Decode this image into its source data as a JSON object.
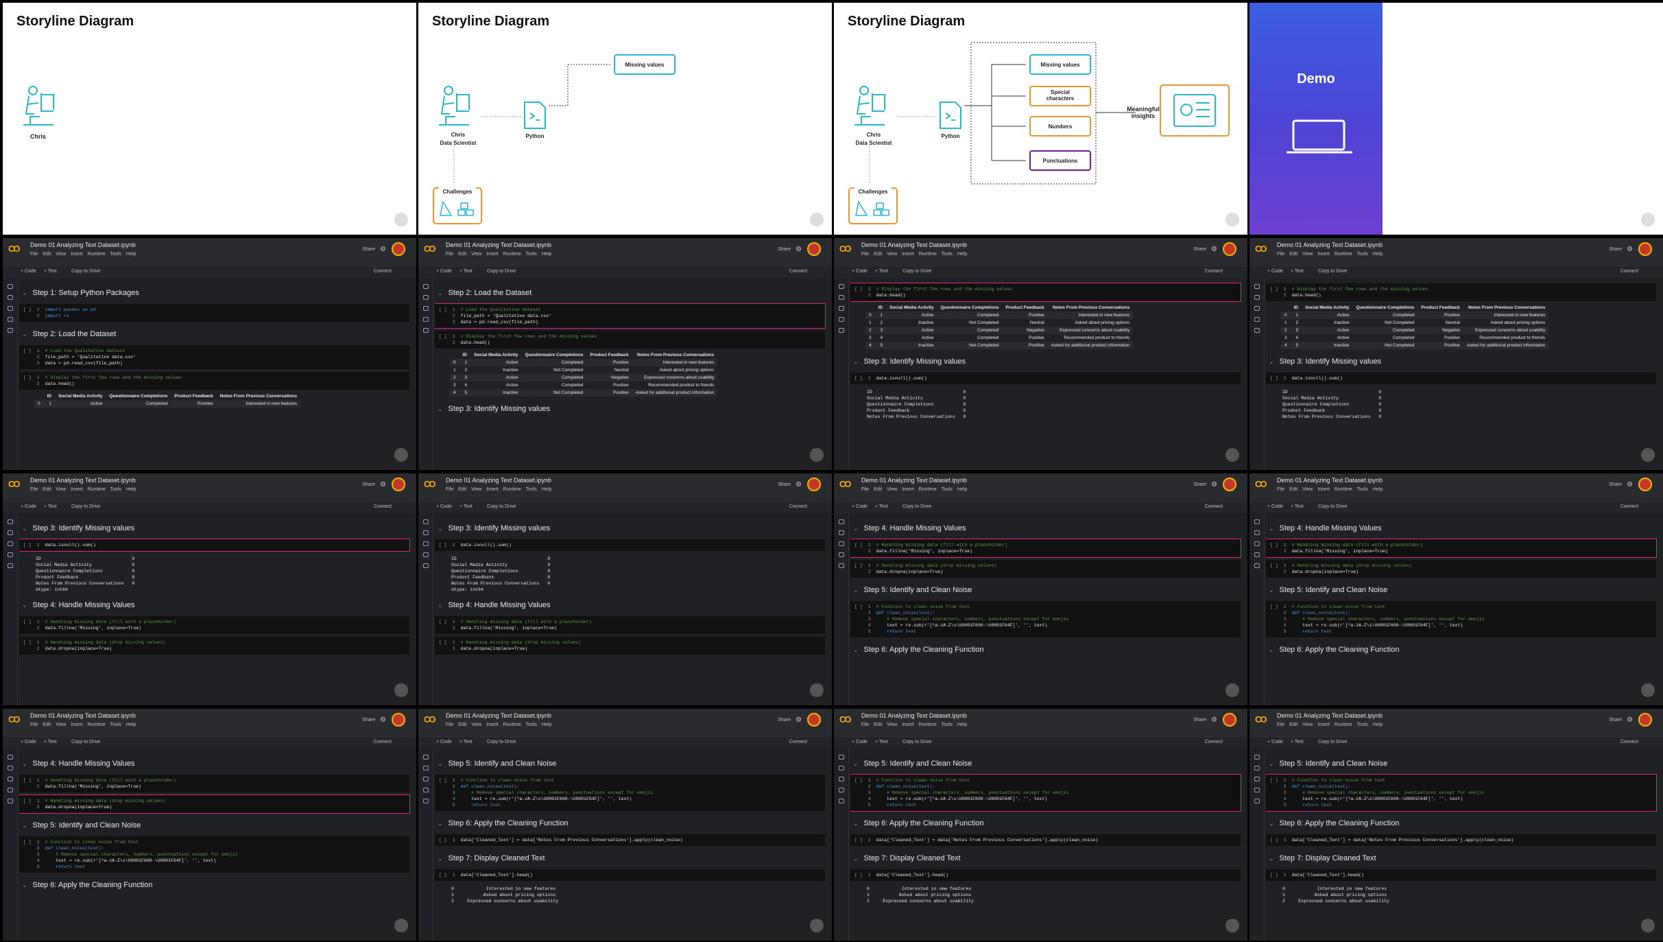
{
  "slides": {
    "title": "Storyline Diagram",
    "chris": "Chris",
    "role": "Data Scientist",
    "python": "Python",
    "challenges": "Challenges",
    "missing": "Missing values",
    "special": "Special characters",
    "numbers": "Numbers",
    "punct": "Punctuations",
    "insights": "Meaningful insights",
    "demo": "Demo"
  },
  "colab": {
    "title": "Demo 01 Analyzing Text Dataset.ipynb",
    "menu": "File Edit View Insert Runtime Tools Help",
    "share": "Share",
    "code": "+ Code",
    "text": "+ Text",
    "copy": "Copy to Drive",
    "connect": "Connect"
  },
  "steps": {
    "s1": "Step 1: Setup Python Packages",
    "s2": "Step 2: Load the Dataset",
    "s3": "Step 3: Identify Missing values",
    "s4": "Step 4: Handle Missing Values",
    "s5": "Step 5: Identify and Clean Noise",
    "s6": "Step 6: Apply the Cleaning Function",
    "s7": "Step 7: Display Cleaned Text"
  },
  "code": {
    "imp1": "import pandas as pd",
    "imp2": "import re",
    "load_c": "# Load the Qualitative dataset",
    "load_1": "file_path = 'Qualitative data.csv'",
    "load_2": "data = pd.read_csv(file_path)",
    "head_c": "# Display the first few rows and the missing values",
    "head_1": "data.head()",
    "isnull": "data.isnull().sum()",
    "fill_c": "# Handling missing data (fill with a placeholder)",
    "fill_1": "data.fillna('Missing', inplace=True)",
    "drop_c": "# Handling missing data (drop missing values)",
    "drop_1": "data.dropna(inplace=True)",
    "fn_c": "# Function to clean noise from text",
    "fn_1": "def clean_noise(text):",
    "fn_2": "    # Remove special characters, numbers, punctuations except for emojis",
    "fn_3": "    text = re.sub(r'[^a-zA-Z\\s\\U0001F600-\\U0001F64F]', '', text)",
    "fn_4": "    return text",
    "apply": "data['Cleaned_Text'] = data['Notes From Previous Conversations'].apply(clean_noise)",
    "show": "data['Cleaned_Text'].head()"
  },
  "table": {
    "headers": [
      "",
      "ID",
      "Social Media Activity",
      "Questionnaire Completions",
      "Product Feedback",
      "Notes From Previous Conversations"
    ],
    "rows": [
      [
        "0",
        "1",
        "Active",
        "Completed",
        "Positive",
        "Interested in new features"
      ],
      [
        "1",
        "2",
        "Inactive",
        "Not Completed",
        "Neutral",
        "Asked about pricing options"
      ],
      [
        "2",
        "3",
        "Active",
        "Completed",
        "Negative",
        "Expressed concerns about usability"
      ],
      [
        "3",
        "4",
        "Active",
        "Completed",
        "Positive",
        "Recommended product to friends"
      ],
      [
        "4",
        "5",
        "Inactive",
        "Not Completed",
        "Positive",
        "Asked for additional product information"
      ]
    ]
  },
  "nulls": {
    "lines": [
      "ID                                  0",
      "Social Media Activity               0",
      "Questionnaire Completions           0",
      "Product Feedback                    0",
      "Notes From Previous Conversations   0",
      "dtype: int64"
    ]
  },
  "cleaned": {
    "lines": [
      "0            Interested in new features",
      "1           Asked about pricing options",
      "2     Expressed concerns about usability"
    ]
  },
  "colors": {
    "accent": "#e0287d",
    "teal": "#29b6d0",
    "orange": "#e8962e",
    "purple": "#6a1b9a"
  }
}
